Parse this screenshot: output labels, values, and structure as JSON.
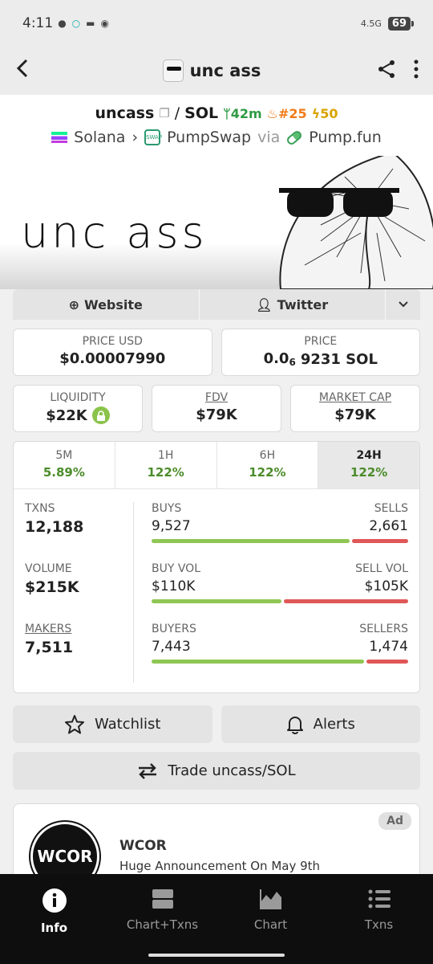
{
  "status_bar": {
    "time": "4:11",
    "network": "4.5G",
    "battery": "69"
  },
  "app_bar": {
    "title": "unc ass"
  },
  "pair": {
    "base": "uncass",
    "separator": "/",
    "quote": "SOL",
    "age": "42m",
    "rank": "#25",
    "boost": "50",
    "chain": "Solana",
    "dex": "PumpSwap",
    "via": "via",
    "launchpad": "Pump.fun"
  },
  "banner": {
    "text": "unc ass"
  },
  "links": {
    "website": "Website",
    "twitter": "Twitter"
  },
  "prices": {
    "price_usd_label": "PRICE USD",
    "price_usd": "$0.00007990",
    "price_label": "PRICE",
    "price_prefix": "0.0",
    "price_sub": "6",
    "price_rest": "9231 SOL"
  },
  "metrics": {
    "liquidity_label": "LIQUIDITY",
    "liquidity": "$22K",
    "fdv_label": "FDV",
    "fdv": "$79K",
    "mcap_label": "MARKET CAP",
    "mcap": "$79K"
  },
  "tabs": [
    {
      "label": "5M",
      "value": "5.89%"
    },
    {
      "label": "1H",
      "value": "122%"
    },
    {
      "label": "6H",
      "value": "122%"
    },
    {
      "label": "24H",
      "value": "122%"
    }
  ],
  "stats": {
    "txns_label": "TXNS",
    "txns": "12,188",
    "volume_label": "VOLUME",
    "volume": "$215K",
    "makers_label": "MAKERS",
    "makers": "7,511",
    "buys_label": "BUYS",
    "buys": "9,527",
    "sells_label": "SELLS",
    "sells": "2,661",
    "buys_share": 0.78,
    "buyvol_label": "BUY VOL",
    "buyvol": "$110K",
    "sellvol_label": "SELL VOL",
    "sellvol": "$105K",
    "buyvol_share": 0.51,
    "buyers_label": "BUYERS",
    "buyers": "7,443",
    "sellers_label": "SELLERS",
    "sellers": "1,474",
    "buyers_share": 0.835
  },
  "buttons": {
    "watchlist": "Watchlist",
    "alerts": "Alerts",
    "trade": "Trade uncass/SOL"
  },
  "ad": {
    "badge": "Ad",
    "logo_text": "WCOR",
    "title": "WCOR",
    "subtitle": "Huge Announcement On May 9th"
  },
  "bottom_nav": [
    {
      "label": "Info"
    },
    {
      "label": "Chart+Txns"
    },
    {
      "label": "Chart"
    },
    {
      "label": "Txns"
    }
  ]
}
